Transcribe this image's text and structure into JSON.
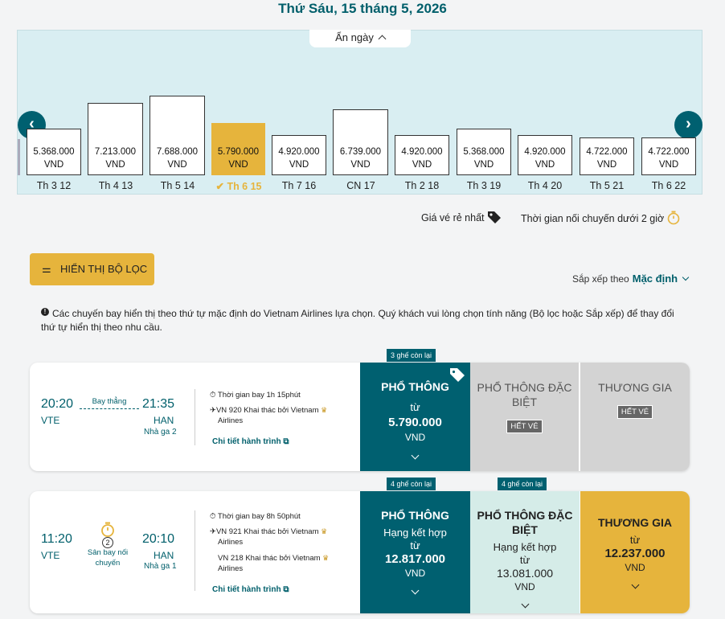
{
  "header": {
    "date_title": "Thứ Sáu, 15 tháng 5, 2026"
  },
  "date_strip": {
    "hide_label": "Ẩn ngày",
    "days": [
      {
        "price": "5.368.000",
        "currency": "VND",
        "label": "Th 3 12",
        "selected": false
      },
      {
        "price": "7.213.000",
        "currency": "VND",
        "label": "Th 4 13",
        "selected": false
      },
      {
        "price": "7.688.000",
        "currency": "VND",
        "label": "Th 5 14",
        "selected": false
      },
      {
        "price": "5.790.000",
        "currency": "VND",
        "label": "Th 6 15",
        "selected": true
      },
      {
        "price": "4.920.000",
        "currency": "VND",
        "label": "Th 7 16",
        "selected": false
      },
      {
        "price": "6.739.000",
        "currency": "VND",
        "label": "CN 17",
        "selected": false
      },
      {
        "price": "4.920.000",
        "currency": "VND",
        "label": "Th 2 18",
        "selected": false
      },
      {
        "price": "5.368.000",
        "currency": "VND",
        "label": "Th 3 19",
        "selected": false
      },
      {
        "price": "4.920.000",
        "currency": "VND",
        "label": "Th 4 20",
        "selected": false
      },
      {
        "price": "4.722.000",
        "currency": "VND",
        "label": "Th 5 21",
        "selected": false
      },
      {
        "price": "4.722.000",
        "currency": "VND",
        "label": "Th 6 22",
        "selected": false
      }
    ]
  },
  "legend": {
    "cheapest": "Giá vé rẻ nhất",
    "short_connection": "Thời gian nối chuyến dưới 2 giờ"
  },
  "filter": {
    "label": "HIỂN THỊ BỘ LỌC"
  },
  "sort": {
    "label": "Sắp xếp theo",
    "value": "Mặc định"
  },
  "info": {
    "text": "Các chuyến bay hiển thị theo thứ tự mặc định do Vietnam Airlines lựa chọn. Quý khách vui lòng chọn tính năng (Bộ lọc hoặc Sắp xếp) để thay đổi thứ tự hiển thị theo nhu cầu."
  },
  "flights": [
    {
      "dep_time": "20:20",
      "dep_code": "VTE",
      "arr_time": "21:35",
      "arr_code": "HAN",
      "terminal": "Nhà ga 2",
      "stop_label": "Bay thẳng",
      "duration": "Thời gian bay 1h 15phút",
      "segments": [
        {
          "flight": "VN 920 Khai thác bởi Vietnam",
          "airline": "Airlines"
        }
      ],
      "details_link": "Chi tiết hành trình",
      "fares": {
        "economy": {
          "seats": "3 ghế còn lại",
          "name": "PHỔ THÔNG",
          "from": "từ",
          "price": "5.790.000",
          "currency": "VND"
        },
        "premium": {
          "name": "PHỔ THÔNG ĐẶC BIỆT",
          "status": "HẾT VÉ"
        },
        "business": {
          "name": "THƯƠNG GIA",
          "status": "HẾT VÉ"
        }
      }
    },
    {
      "dep_time": "11:20",
      "dep_code": "VTE",
      "arr_time": "20:10",
      "arr_code": "HAN",
      "terminal": "Nhà ga 1",
      "stops": "2",
      "stop_label": "Sân bay nối chuyến",
      "duration": "Thời gian bay 8h 50phút",
      "segments": [
        {
          "flight": "VN 921 Khai thác bởi Vietnam",
          "airline": "Airlines"
        },
        {
          "flight": "VN 218 Khai thác bởi Vietnam",
          "airline": "Airlines"
        }
      ],
      "details_link": "Chi tiết hành trình",
      "fares": {
        "economy": {
          "seats": "4 ghế còn lại",
          "name": "PHỔ THÔNG",
          "sub": "Hạng kết hợp",
          "from": "từ",
          "price": "12.817.000",
          "currency": "VND"
        },
        "premium": {
          "seats": "4 ghế còn lại",
          "name": "PHỔ THÔNG ĐẶC BIỆT",
          "sub": "Hạng kết hợp",
          "from": "từ",
          "price": "13.081.000",
          "currency": "VND"
        },
        "business": {
          "name": "THƯƠNG GIA",
          "from": "từ",
          "price": "12.237.000",
          "currency": "VND"
        }
      }
    }
  ],
  "colors": {
    "teal": "#006070",
    "gold": "#e6b43c",
    "strip_bg": "#d9eef2"
  }
}
